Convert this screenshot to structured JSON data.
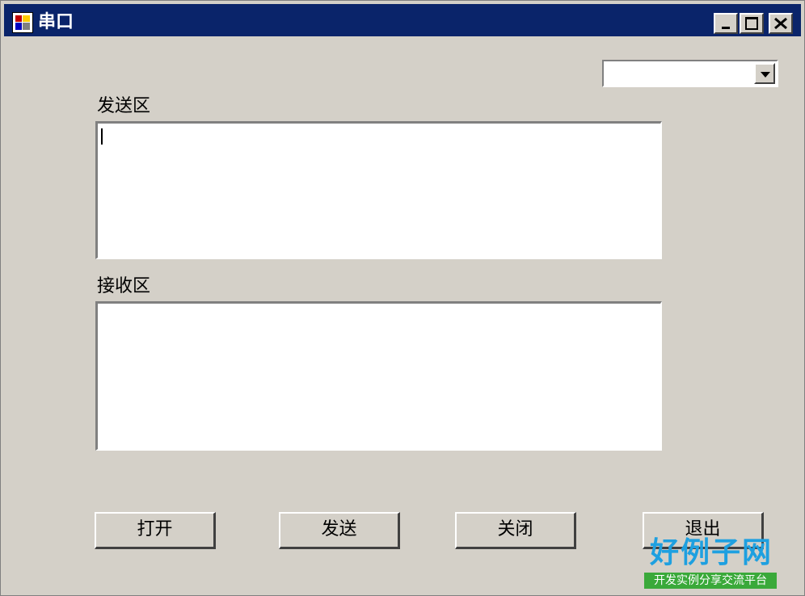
{
  "window": {
    "title": "串口",
    "controls": {
      "minimize": "_",
      "maximize": "□",
      "close": "✕"
    }
  },
  "combo": {
    "value": ""
  },
  "send_area": {
    "label": "发送区",
    "value": ""
  },
  "receive_area": {
    "label": "接收区",
    "value": ""
  },
  "buttons": {
    "open": "打开",
    "send": "发送",
    "close": "关闭",
    "exit": "退出"
  },
  "watermark": {
    "main": "好例子网",
    "sub": "开发实例分享交流平台"
  },
  "colors": {
    "titlebar": "#0a246a",
    "face": "#d4d0c8",
    "watermark_blue": "#1ea0e0",
    "watermark_green": "#3aa93a"
  }
}
